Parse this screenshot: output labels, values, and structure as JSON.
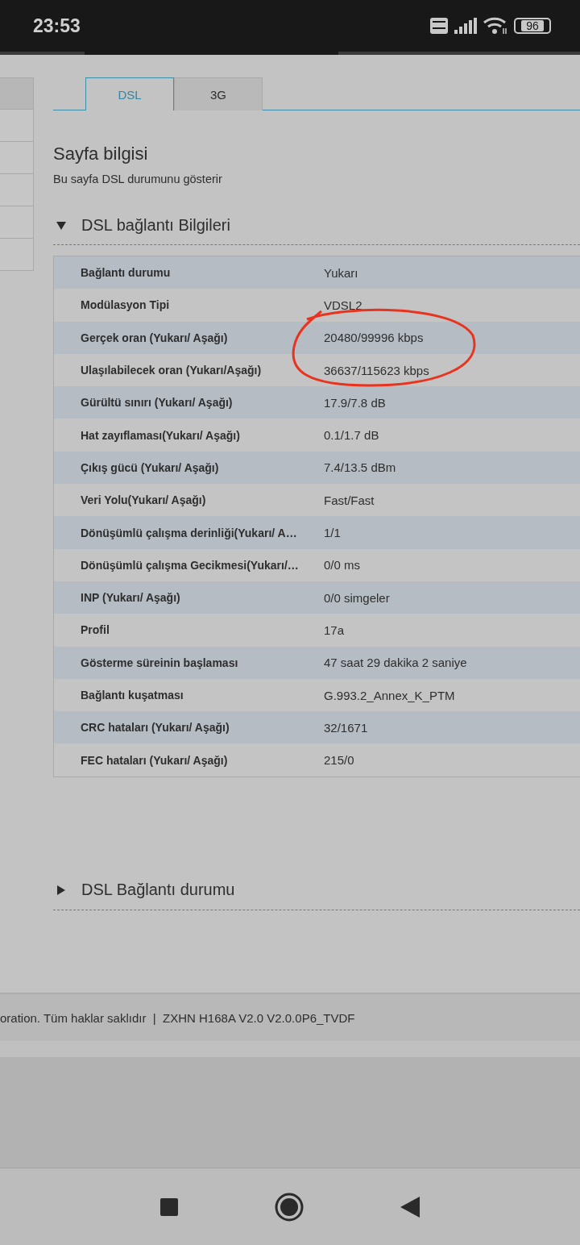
{
  "status_bar": {
    "time": "23:53",
    "battery": "96"
  },
  "tabs": [
    {
      "label": "DSL",
      "selected": true
    },
    {
      "label": "3G",
      "selected": false
    }
  ],
  "page_info": {
    "title": "Sayfa bilgisi",
    "description": "Bu sayfa DSL durumunu gösterir"
  },
  "sections": [
    {
      "title": "DSL bağlantı Bilgileri",
      "expanded": true,
      "rows": [
        {
          "label": "Bağlantı durumu",
          "value": "Yukarı"
        },
        {
          "label": "Modülasyon Tipi",
          "value": "VDSL2"
        },
        {
          "label": "Gerçek oran (Yukarı/ Aşağı)",
          "value": "20480/99996 kbps"
        },
        {
          "label": "Ulaşılabilecek oran (Yukarı/Aşağı)",
          "value": "36637/115623 kbps"
        },
        {
          "label": "Gürültü sınırı (Yukarı/ Aşağı)",
          "value": "17.9/7.8 dB"
        },
        {
          "label": "Hat zayıflaması(Yukarı/ Aşağı)",
          "value": "0.1/1.7 dB"
        },
        {
          "label": "Çıkış gücü (Yukarı/ Aşağı)",
          "value": "7.4/13.5 dBm"
        },
        {
          "label": "Veri Yolu(Yukarı/ Aşağı)",
          "value": "Fast/Fast"
        },
        {
          "label": "Dönüşümlü çalışma derinliği(Yukarı/ A…",
          "value": "1/1"
        },
        {
          "label": "Dönüşümlü çalışma Gecikmesi(Yukarı/…",
          "value": "0/0 ms"
        },
        {
          "label": "INP (Yukarı/ Aşağı)",
          "value": "0/0 simgeler"
        },
        {
          "label": "Profil",
          "value": "17a"
        },
        {
          "label": "Gösterme süreinin başlaması",
          "value": "47 saat 29 dakika 2 saniye"
        },
        {
          "label": "Bağlantı kuşatması",
          "value": "G.993.2_Annex_K_PTM"
        },
        {
          "label": "CRC hataları (Yukarı/ Aşağı)",
          "value": "32/1671"
        },
        {
          "label": "FEC hataları (Yukarı/ Aşağı)",
          "value": "215/0"
        }
      ]
    },
    {
      "title": "DSL Bağlantı durumu",
      "expanded": false
    }
  ],
  "sidebar": {
    "items": [
      {
        "selected": true
      },
      {
        "selected": false
      },
      {
        "selected": false
      },
      {
        "selected": false
      },
      {
        "selected": false
      },
      {
        "selected": false
      }
    ]
  },
  "footer": {
    "text": "oration. Tüm haklar saklıdır  |  ZXHN H168A V2.0 V2.0.0P6_TVDF"
  }
}
